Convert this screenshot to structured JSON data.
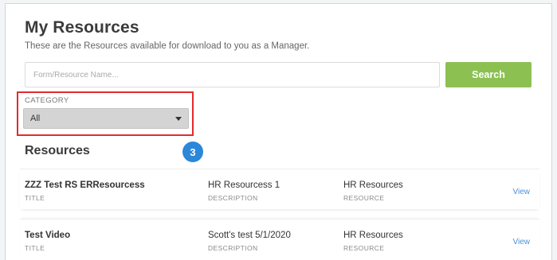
{
  "header": {
    "title": "My Resources",
    "subtitle": "These are the Resources available for download to you as a Manager."
  },
  "search": {
    "placeholder": "Form/Resource Name...",
    "value": "",
    "button_label": "Search"
  },
  "category": {
    "label": "CATEGORY",
    "selected": "All"
  },
  "step_badge": "3",
  "section": {
    "heading": "Resources"
  },
  "resources": [
    {
      "title": "ZZZ Test RS ERResourcess",
      "title_label": "TITLE",
      "description": "HR Resourcess 1",
      "description_label": "DESCRIPTION",
      "resource": "HR Resources",
      "resource_label": "RESOURCE",
      "action": "View"
    },
    {
      "title": "Test Video",
      "title_label": "TITLE",
      "description": "Scott's test 5/1/2020",
      "description_label": "DESCRIPTION",
      "resource": "HR Resources",
      "resource_label": "RESOURCE",
      "action": "View"
    }
  ],
  "colors": {
    "search_button": "#8cc152",
    "highlight_border": "#e02c2c",
    "step_badge": "#2b87d9",
    "link": "#4a90d9"
  }
}
